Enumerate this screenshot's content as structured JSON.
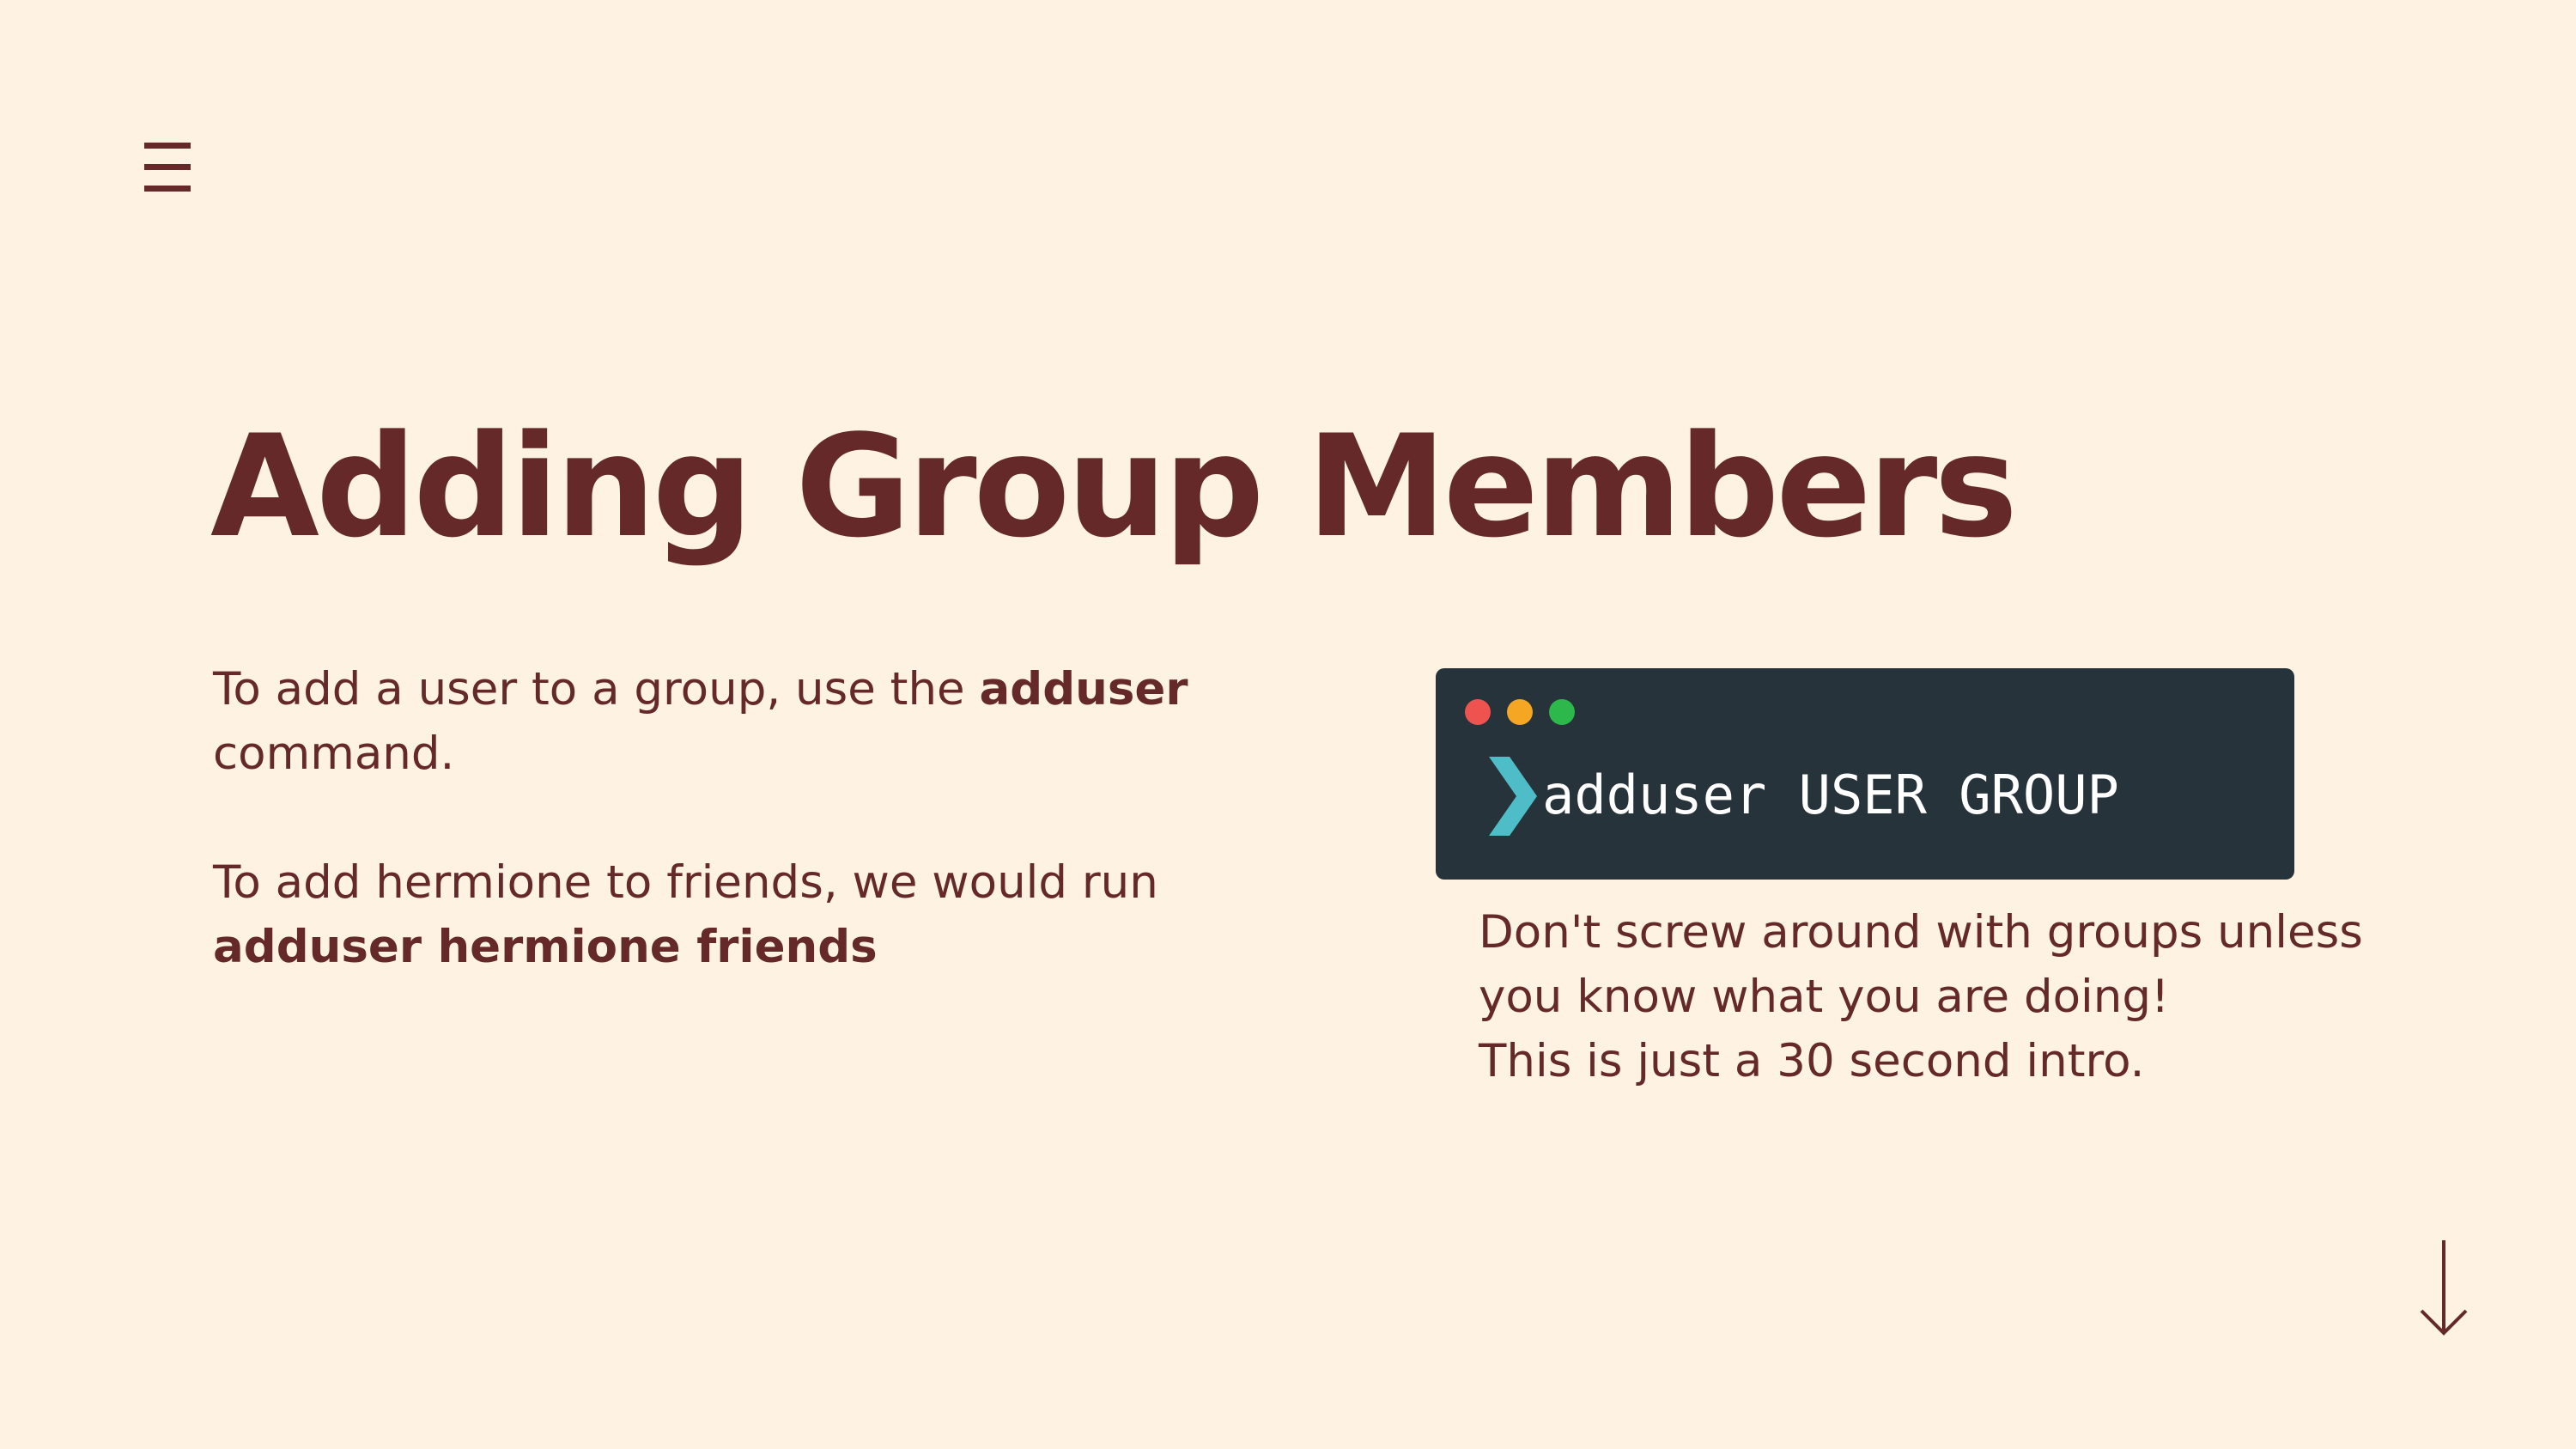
{
  "nav": {
    "menu_icon": "hamburger-menu-icon",
    "scroll_icon": "arrow-down-icon"
  },
  "slide": {
    "title": "Adding Group Members",
    "para1": {
      "text": "To add a user to a group, use the ",
      "bold": "adduser",
      "line2": "command."
    },
    "para2": {
      "text": "To add hermione to friends, we would run",
      "bold": "adduser hermione friends"
    }
  },
  "terminal": {
    "command": "adduser USER GROUP",
    "prompt_icon": "chevron-right-icon",
    "dots": [
      "#EF5350",
      "#F5A623",
      "#2DB84C"
    ],
    "prompt_color": "#4FBDC7",
    "background": "#27333A"
  },
  "caption": {
    "line1": "Don't screw around with groups unless",
    "line2": "you know what you are doing!",
    "line3": "This is just a 30 second intro."
  },
  "colors": {
    "background": "#FEF3E2",
    "text": "#65292A"
  }
}
